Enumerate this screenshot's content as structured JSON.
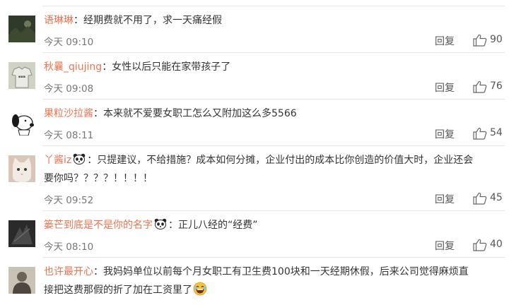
{
  "comments": [
    {
      "username": "语琳琳",
      "text": "经期费就不用了，求一天痛经假",
      "time": "今天 09:10",
      "reply": "回复",
      "likes": "90",
      "avatar_icon": "dark-landscape-avatar"
    },
    {
      "username": "秋曩_qiujing",
      "text": "女性以后只能在家带孩子了",
      "time": "今天 09:08",
      "reply": "回复",
      "likes": "76",
      "avatar_icon": "shirt-avatar"
    },
    {
      "username": "果粒沙拉酱",
      "text": "本来就不爱要女职工怎么又附加这么多5566",
      "time": "今天 08:11",
      "reply": "回复",
      "likes": "54",
      "avatar_icon": "snoopy-avatar"
    },
    {
      "username": "丫酱iz",
      "text_line1": "只提建议，不给措施？成本如何分摊，企业付出的成本比你创造的价值大时，企业还会",
      "text_line2": "要你吗？？？？！！！！",
      "time": "今天 09:52",
      "reply": "回复",
      "likes": "45",
      "avatar_icon": "cat-avatar",
      "badge_icon": "panda-icon"
    },
    {
      "username": "篓芒到底是不是你的名字",
      "text": "正儿八经的“经费”",
      "time": "今天 08:10",
      "reply": "回复",
      "likes": "40",
      "avatar_icon": "dark-avatar",
      "badge_icon": "panda-icon"
    },
    {
      "username": "也许最开心",
      "text_line1": "我妈妈单位以前每个月女职工有卫生费100块和一天经期休假，后来公司觉得麻烦直",
      "text_line2": "接把这费那假的折了加在工资里了",
      "avatar_icon": "person-avatar",
      "emoji_icon": "laughing-emoji-icon"
    }
  ],
  "colors": {
    "username": "#eb7350",
    "text": "#333333",
    "meta": "#777777",
    "divider": "#e6e6e6"
  },
  "separator": "："
}
